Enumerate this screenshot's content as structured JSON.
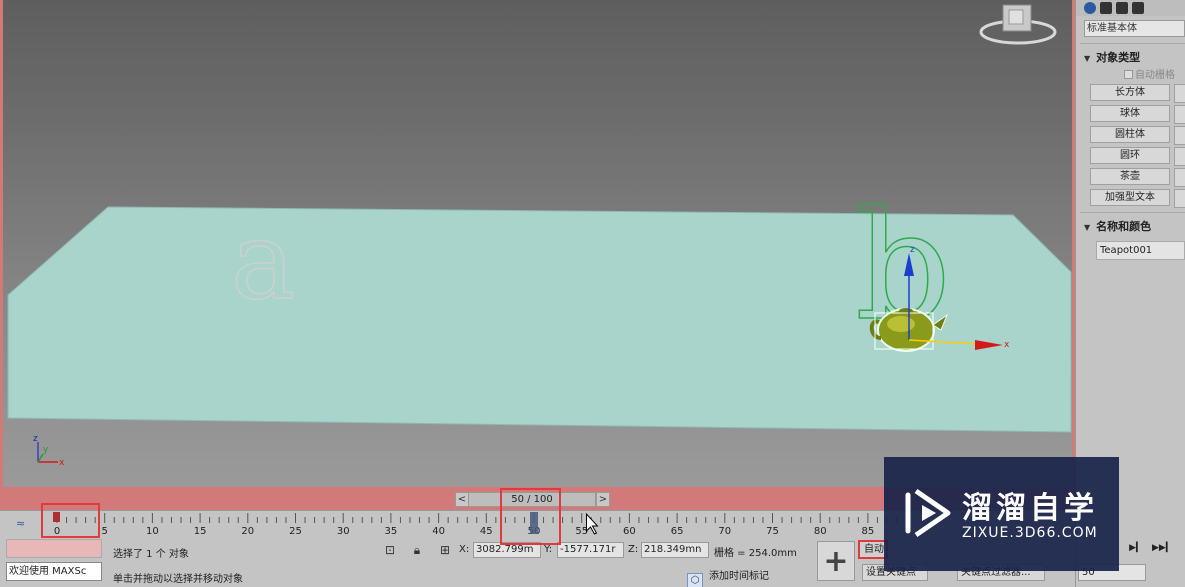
{
  "command_panel": {
    "category_dropdown": "标准基本体",
    "object_type_header": "对象类型",
    "autogrid_label": "自动栅格",
    "object_buttons": [
      "长方体",
      "球体",
      "圆柱体",
      "圆环",
      "茶壶",
      "加强型文本"
    ],
    "name_color_header": "名称和颜色",
    "object_name": "Teapot001"
  },
  "viewport": {
    "axis_labels": {
      "x": "x",
      "y": "y",
      "z": "z"
    },
    "text_objects": [
      "a",
      "b"
    ],
    "colors": {
      "plane": "#a8d4cc",
      "teapot": "#8a9a1a",
      "text_b": "#2faa4a",
      "text_a": "#c8c8c8"
    }
  },
  "time_slider": {
    "prev_label": "<",
    "next_label": ">",
    "position_label": "50 / 100",
    "current_frame": 50,
    "total_frames": 100
  },
  "trackbar": {
    "ticks": [
      "0",
      "5",
      "10",
      "15",
      "20",
      "25",
      "30",
      "35",
      "40",
      "45",
      "50",
      "55",
      "60",
      "65",
      "70",
      "75",
      "80",
      "85"
    ]
  },
  "status": {
    "maxscript_prompt": "欢迎使用 MAXSc",
    "selection_message": "选择了 1 个 对象",
    "hint_message": "单击并拖动以选择并移动对象",
    "x_label": "X:",
    "x_value": "3082.799m",
    "y_label": "Y:",
    "y_value": "-1577.171r",
    "z_label": "Z:",
    "z_value": "218.349mn",
    "grid_text": "栅格 = 254.0mm",
    "add_time_tag": "添加时间标记",
    "auto_key": "自动",
    "set_key": "设置关键点",
    "key_filters": "关键点过滤器...",
    "frame_field": "50"
  },
  "watermark": {
    "title": "溜溜自学",
    "url": "ZIXUE.3D66.COM"
  }
}
